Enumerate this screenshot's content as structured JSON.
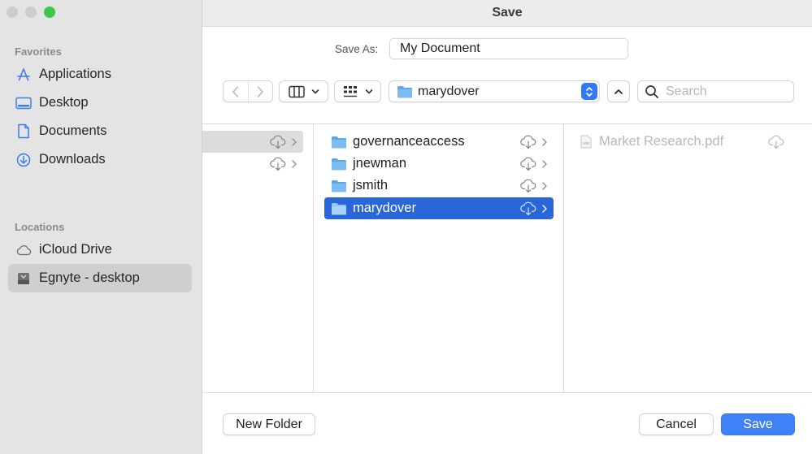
{
  "window": {
    "title": "Save"
  },
  "sidebar": {
    "favorites_title": "Favorites",
    "favorites": [
      {
        "label": "Applications",
        "icon": "applications-icon"
      },
      {
        "label": "Desktop",
        "icon": "desktop-icon"
      },
      {
        "label": "Documents",
        "icon": "document-icon"
      },
      {
        "label": "Downloads",
        "icon": "downloads-icon"
      }
    ],
    "locations_title": "Locations",
    "locations": [
      {
        "label": "iCloud Drive",
        "icon": "cloud-icon"
      },
      {
        "label": "Egnyte - desktop",
        "icon": "drive-icon",
        "selected": true
      }
    ]
  },
  "saveas": {
    "label": "Save As:",
    "value": "My Document"
  },
  "toolbar": {
    "location": "marydover",
    "search_placeholder": "Search"
  },
  "browser": {
    "column2": [
      {
        "name": "governanceaccess"
      },
      {
        "name": "jnewman"
      },
      {
        "name": "jsmith"
      },
      {
        "name": "marydover",
        "selected": true
      }
    ],
    "column3": [
      {
        "name": "Market Research.pdf",
        "disabled": true
      }
    ]
  },
  "buttons": {
    "new_folder": "New Folder",
    "cancel": "Cancel",
    "save": "Save"
  },
  "colors": {
    "accent": "#3f82f7",
    "selection": "#2966d7",
    "maximize": "#3ec74b"
  }
}
